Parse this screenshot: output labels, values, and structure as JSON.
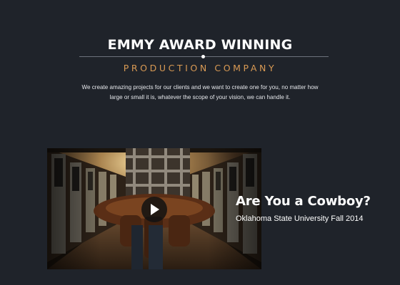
{
  "hero": {
    "title": "EMMY AWARD WINNING",
    "subtitle": "PRODUCTION COMPANY",
    "intro_line1": "We create amazing projects for our clients and we want to create one for you, no matter how",
    "intro_line2": "large or small it is, whatever the scope of your vision, we can handle it."
  },
  "featured_video": {
    "title": "Are You a Cowboy?",
    "subtitle": "Oklahoma State University Fall 2014",
    "play_icon": "play-icon"
  },
  "colors": {
    "background": "#1f232a",
    "accent": "#d99a54",
    "text": "#ffffff"
  }
}
